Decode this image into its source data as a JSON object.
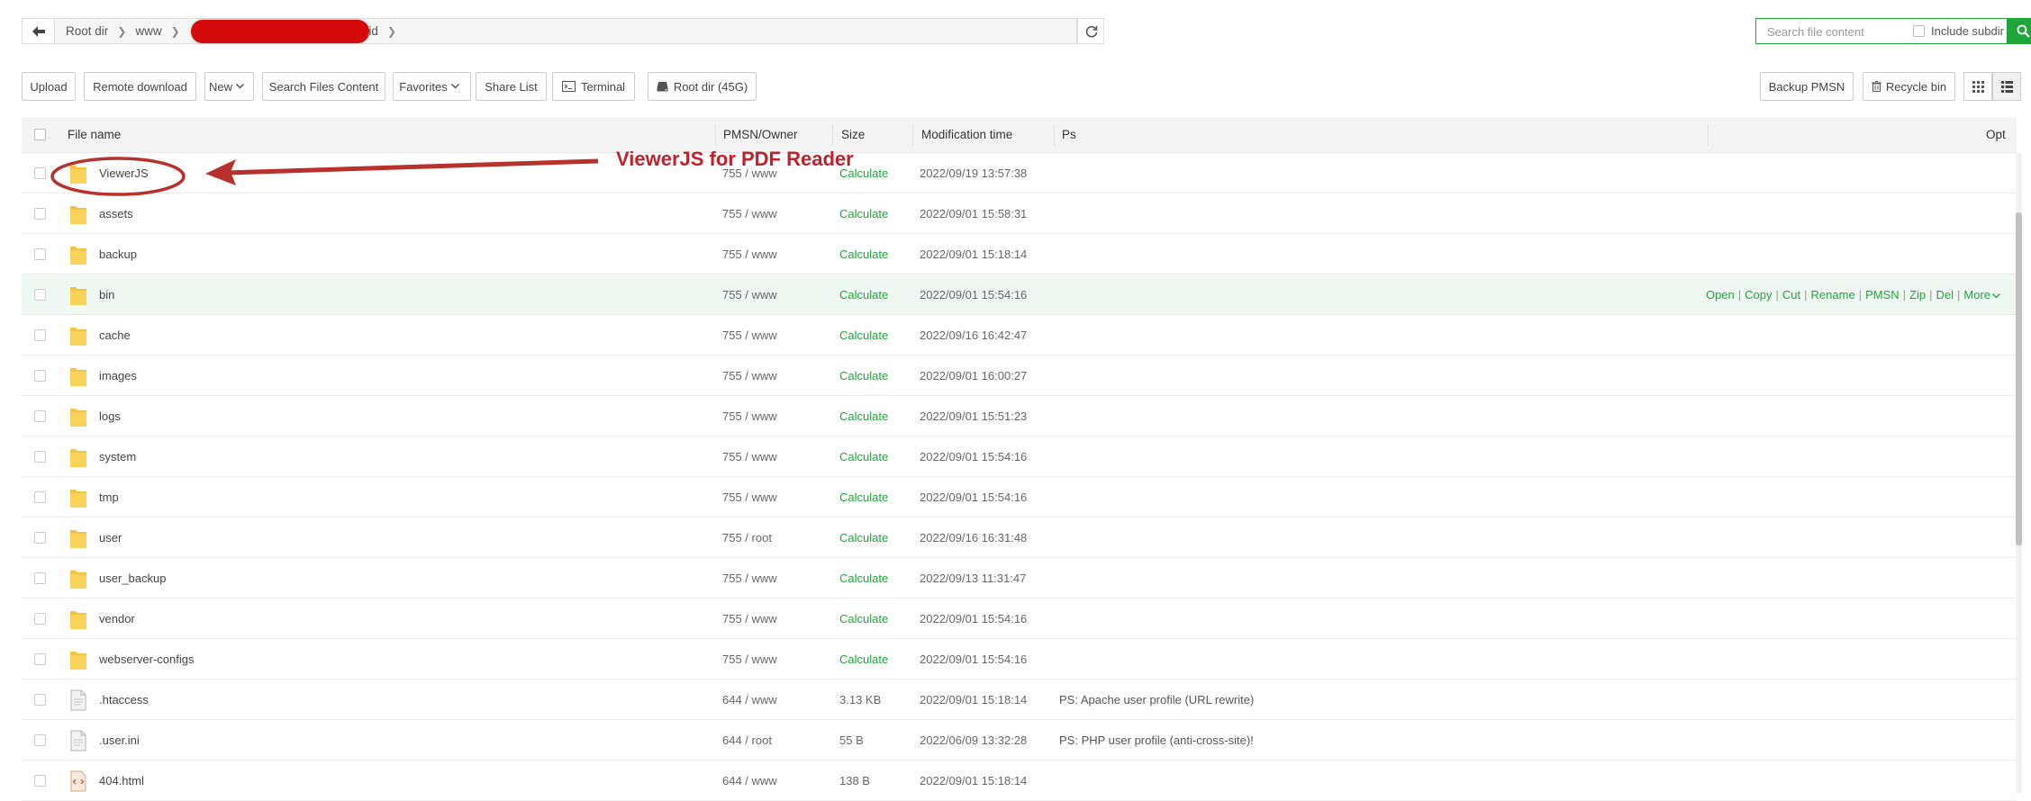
{
  "path_bar": {
    "crumbs": [
      "Root dir",
      "www",
      ".id"
    ]
  },
  "search": {
    "placeholder": "Search file content",
    "include_subdir_label": "Include subdir"
  },
  "toolbar": {
    "upload": "Upload",
    "remote_download": "Remote download",
    "new": "New",
    "search_files_content": "Search Files Content",
    "favorites": "Favorites",
    "share_list": "Share List",
    "terminal": "Terminal",
    "root_dir": "Root dir (45G)",
    "backup_pmsn": "Backup PMSN",
    "recycle_bin": "Recycle bin"
  },
  "table": {
    "columns": {
      "name": "File name",
      "perm": "PMSN/Owner",
      "size": "Size",
      "mtime": "Modification time",
      "ps": "Ps",
      "opt": "Opt"
    },
    "rows": [
      {
        "name": "ViewerJS",
        "type": "folder",
        "perm": "755 / www",
        "size": "Calculate",
        "mtime": "2022/09/19 13:57:38",
        "ps": ""
      },
      {
        "name": "assets",
        "type": "folder",
        "perm": "755 / www",
        "size": "Calculate",
        "mtime": "2022/09/01 15:58:31",
        "ps": ""
      },
      {
        "name": "backup",
        "type": "folder",
        "perm": "755 / www",
        "size": "Calculate",
        "mtime": "2022/09/01 15:18:14",
        "ps": ""
      },
      {
        "name": "bin",
        "type": "folder",
        "perm": "755 / www",
        "size": "Calculate",
        "mtime": "2022/09/01 15:54:16",
        "ps": ""
      },
      {
        "name": "cache",
        "type": "folder",
        "perm": "755 / www",
        "size": "Calculate",
        "mtime": "2022/09/16 16:42:47",
        "ps": ""
      },
      {
        "name": "images",
        "type": "folder",
        "perm": "755 / www",
        "size": "Calculate",
        "mtime": "2022/09/01 16:00:27",
        "ps": ""
      },
      {
        "name": "logs",
        "type": "folder",
        "perm": "755 / www",
        "size": "Calculate",
        "mtime": "2022/09/01 15:51:23",
        "ps": ""
      },
      {
        "name": "system",
        "type": "folder",
        "perm": "755 / www",
        "size": "Calculate",
        "mtime": "2022/09/01 15:54:16",
        "ps": ""
      },
      {
        "name": "tmp",
        "type": "folder",
        "perm": "755 / www",
        "size": "Calculate",
        "mtime": "2022/09/01 15:54:16",
        "ps": ""
      },
      {
        "name": "user",
        "type": "folder",
        "perm": "755 / root",
        "size": "Calculate",
        "mtime": "2022/09/16 16:31:48",
        "ps": ""
      },
      {
        "name": "user_backup",
        "type": "folder",
        "perm": "755 / www",
        "size": "Calculate",
        "mtime": "2022/09/13 11:31:47",
        "ps": ""
      },
      {
        "name": "vendor",
        "type": "folder",
        "perm": "755 / www",
        "size": "Calculate",
        "mtime": "2022/09/01 15:54:16",
        "ps": ""
      },
      {
        "name": "webserver-configs",
        "type": "folder",
        "perm": "755 / www",
        "size": "Calculate",
        "mtime": "2022/09/01 15:54:16",
        "ps": ""
      },
      {
        "name": ".htaccess",
        "type": "file",
        "perm": "644 / www",
        "size": "3.13 KB",
        "mtime": "2022/09/01 15:18:14",
        "ps": "PS: Apache user profile (URL rewrite)"
      },
      {
        "name": ".user.ini",
        "type": "file",
        "perm": "644 / root",
        "size": "55 B",
        "mtime": "2022/06/09 13:32:28",
        "ps": "PS: PHP user profile (anti-cross-site)!"
      },
      {
        "name": "404.html",
        "type": "html",
        "perm": "644 / www",
        "size": "138 B",
        "mtime": "2022/09/01 15:18:14",
        "ps": ""
      }
    ],
    "hover_row_index": 3,
    "row_ops": [
      "Open",
      "Copy",
      "Cut",
      "Rename",
      "PMSN",
      "Zip",
      "Del",
      "More"
    ]
  },
  "annotation": {
    "text": "ViewerJS for PDF Reader",
    "color": "#c0212a"
  },
  "colors": {
    "accent": "#20a53a",
    "annotation": "#c0212a",
    "redaction": "#d40a0a"
  }
}
